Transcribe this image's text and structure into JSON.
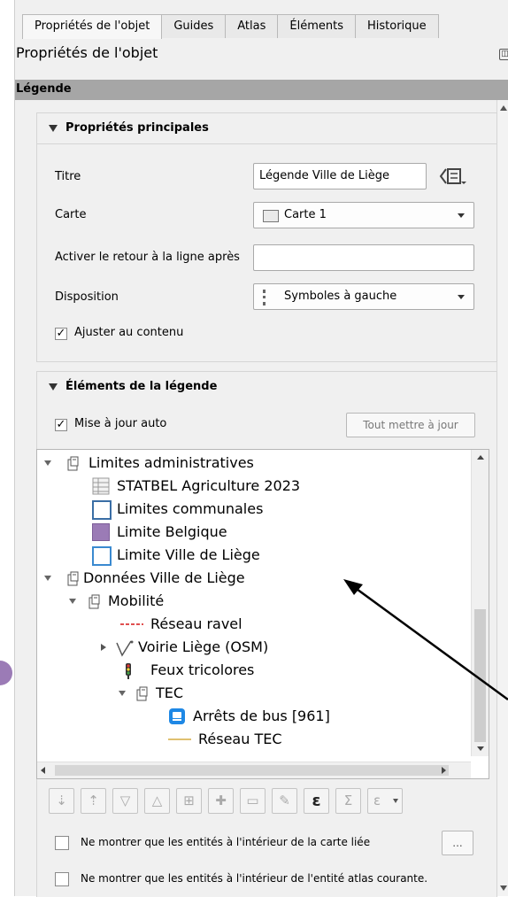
{
  "tabs": [
    {
      "label": "Propriétés de l'objet",
      "active": true
    },
    {
      "label": "Guides"
    },
    {
      "label": "Atlas"
    },
    {
      "label": "Éléments"
    },
    {
      "label": "Historique"
    }
  ],
  "panel_title": "Propriétés de l'objet",
  "section_header": "Légende",
  "main_props": {
    "header": "Propriétés principales",
    "title_label": "Titre",
    "title_value": "Légende Ville de Liège",
    "map_label": "Carte",
    "map_value": "Carte 1",
    "wrap_label": "Activer le retour à la ligne après",
    "wrap_value": "",
    "layout_label": "Disposition",
    "layout_value": "Symboles à gauche",
    "fit_label": "Ajuster au contenu",
    "fit_checked": true
  },
  "legend_items": {
    "header": "Éléments de la légende",
    "auto_update_label": "Mise à jour auto",
    "auto_update_checked": true,
    "update_all_button": "Tout mettre à jour",
    "tree": [
      {
        "label": "Limites administratives",
        "type": "group",
        "level": 0,
        "expanded": true
      },
      {
        "label": "STATBEL Agriculture 2023",
        "type": "table",
        "level": 1
      },
      {
        "label": "Limites communales",
        "type": "polygon-outline",
        "level": 1,
        "color": "#3a6ea5"
      },
      {
        "label": "Limite Belgique",
        "type": "polygon-fill",
        "level": 1,
        "color": "#9b7bb6"
      },
      {
        "label": "Limite Ville de Liège",
        "type": "polygon-outline",
        "level": 1,
        "color": "#3a8ad0"
      },
      {
        "label": "Données Ville de Liège",
        "type": "group",
        "level": 0,
        "expanded": true
      },
      {
        "label": "Mobilité",
        "type": "group",
        "level": 1,
        "expanded": true
      },
      {
        "label": "Réseau ravel",
        "type": "line-dashed",
        "level": 2,
        "color": "#e05050"
      },
      {
        "label": "Voirie Liège (OSM)",
        "type": "rule",
        "level": 2,
        "expanded": false
      },
      {
        "label": "Feux tricolores",
        "type": "traffic-light",
        "level": 2
      },
      {
        "label": "TEC",
        "type": "group",
        "level": 2,
        "expanded": true
      },
      {
        "label": "Arrêts de bus [961]",
        "type": "bus",
        "level": 3,
        "color": "#1e88e5"
      },
      {
        "label": "Réseau TEC",
        "type": "line",
        "level": 3,
        "color": "#e0c070"
      }
    ],
    "filter_map_label": "Ne montrer que les entités à l'intérieur de la carte liée",
    "filter_atlas_label": "Ne montrer que les entités à l'intérieur de l'entité atlas courante.",
    "more_button": "..."
  },
  "toolbar_icons": [
    "move-to-layer-icon",
    "move-up-icon",
    "move-down-icon",
    "move-top-icon",
    "add-group-icon",
    "add-item-icon",
    "remove-item-icon",
    "edit-item-icon",
    "expression-icon",
    "sum-icon",
    "filter-expression-icon"
  ],
  "toolbar_glyphs": [
    "⇣",
    "⇡",
    "▽",
    "△",
    "⊞",
    "✚",
    "▭",
    "✎",
    "ε",
    "Σ",
    "ε"
  ]
}
